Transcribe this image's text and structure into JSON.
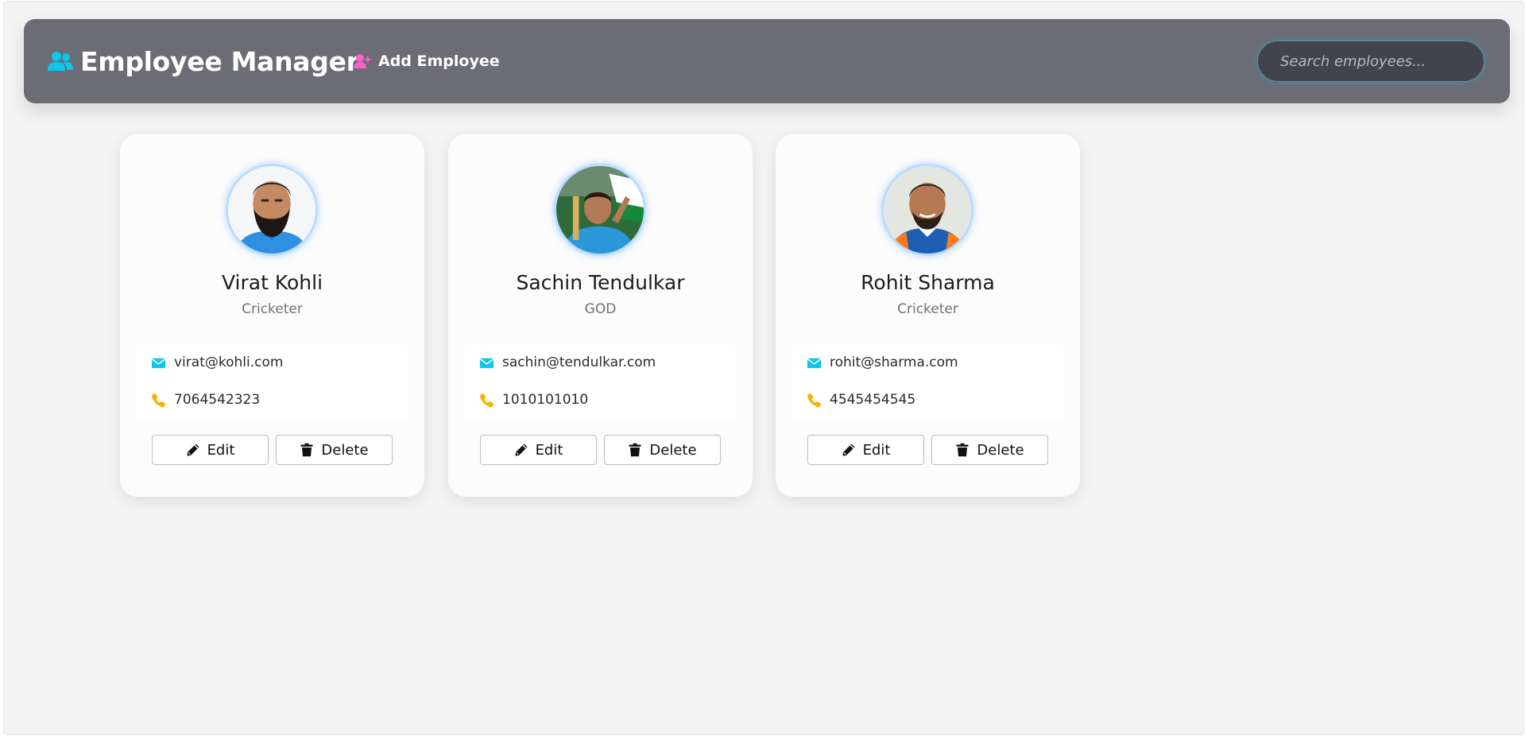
{
  "header": {
    "title": "Employee Manager",
    "title_icon": "users-icon",
    "add_label": "Add Employee",
    "add_icon": "user-plus-icon",
    "search_placeholder": "Search employees..."
  },
  "colors": {
    "navbar": "#6b6c76",
    "accent_cyan": "#0fc6e8",
    "accent_pink": "#ff5fc8",
    "phone_yellow": "#f4b400"
  },
  "employees": [
    {
      "name": "Virat Kohli",
      "role": "Cricketer",
      "email": "virat@kohli.com",
      "phone": "7064542323"
    },
    {
      "name": "Sachin Tendulkar",
      "role": "GOD",
      "email": "sachin@tendulkar.com",
      "phone": "1010101010"
    },
    {
      "name": "Rohit Sharma",
      "role": "Cricketer",
      "email": "rohit@sharma.com",
      "phone": "4545454545"
    }
  ],
  "actions": {
    "edit_label": "Edit",
    "delete_label": "Delete"
  }
}
